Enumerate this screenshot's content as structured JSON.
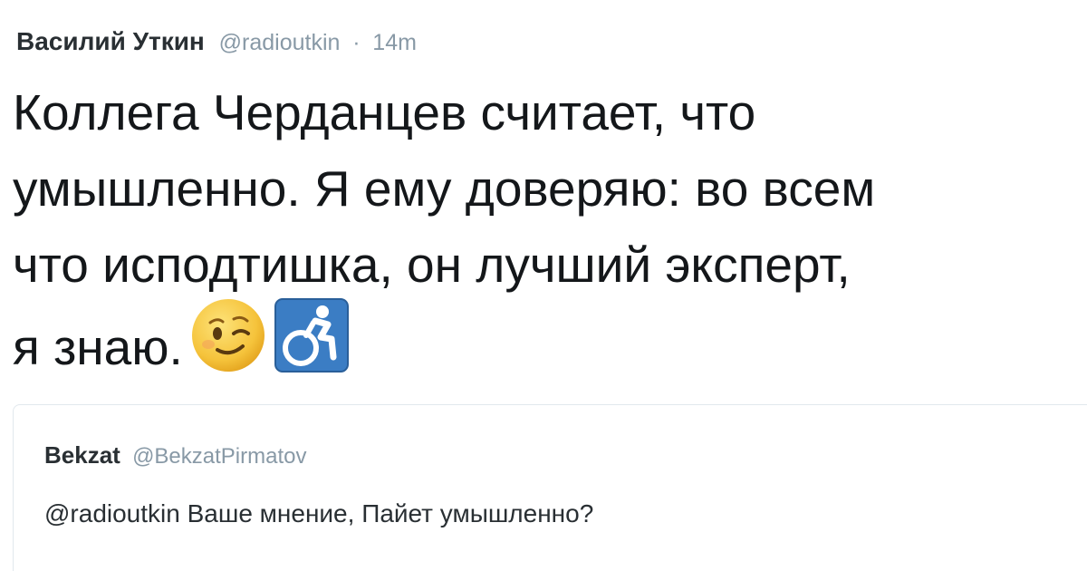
{
  "tweet": {
    "author_name": "Василий Уткин",
    "author_handle": "@radioutkin",
    "separator": "·",
    "time": "14m",
    "text_lines": [
      "Коллега Черданцев считает, что",
      "умышленно. Я ему доверяю: во всем",
      "что исподтишка, он лучший эксперт,",
      "я знаю."
    ],
    "emojis": [
      "winking-face-emoji",
      "wheelchair-symbol-emoji"
    ]
  },
  "quote": {
    "author_name": "Bekzat",
    "author_handle": "@BekzatPirmatov",
    "text": "@radioutkin Ваше мнение, Пайет умышленно?"
  },
  "colors": {
    "text": "#14171a",
    "secondary": "#8899a6",
    "border": "#e1e8ed",
    "emoji_face": "#f5c33b",
    "emoji_blue": "#3b7dc4"
  }
}
